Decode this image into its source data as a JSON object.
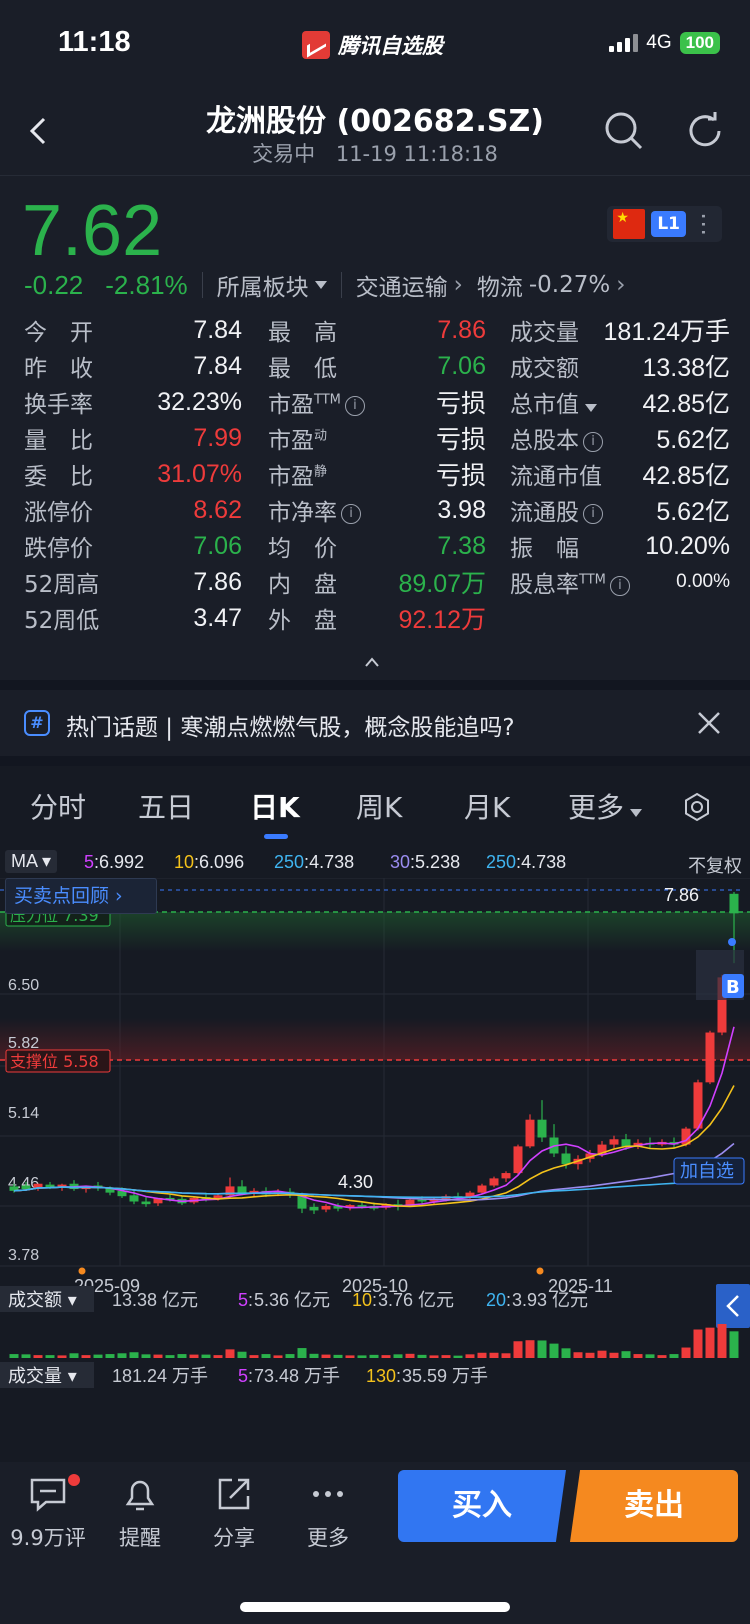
{
  "status_bar": {
    "time": "11:18",
    "app_name": "腾讯自选股",
    "network": "4G",
    "battery": "100"
  },
  "nav": {
    "title": "龙洲股份 (002682.SZ)",
    "trading_status": "交易中",
    "datetime": "11-19 11:18:18"
  },
  "quote": {
    "price": "7.62",
    "change_abs": "-0.22",
    "change_pct": "-2.81%",
    "sector_label": "所属板块",
    "industry_name": "交通运输",
    "sub_industry": "物流",
    "sub_industry_pct": "-0.27%",
    "market_badge": "L1"
  },
  "stats": {
    "open_label": "今　开",
    "open": "7.84",
    "high_label": "最　高",
    "high": "7.86",
    "volume_label": "成交量",
    "volume": "181.24万手",
    "prev_close_label": "昨　收",
    "prev_close": "7.84",
    "low_label": "最　低",
    "low": "7.06",
    "turnover_label": "成交额",
    "turnover": "13.38亿",
    "turnover_rate_label": "换手率",
    "turnover_rate": "32.23%",
    "pe_ttm_label": "市盈",
    "pe_ttm_sup": "TTM",
    "pe_ttm": "亏损",
    "mkt_cap_label": "总市值",
    "mkt_cap": "42.85亿",
    "vol_ratio_label": "量　比",
    "vol_ratio": "7.99",
    "pe_dyn_label": "市盈",
    "pe_dyn_sup": "动",
    "pe_dyn": "亏损",
    "total_shares_label": "总股本",
    "total_shares": "5.62亿",
    "order_ratio_label": "委　比",
    "order_ratio": "31.07%",
    "pe_static_label": "市盈",
    "pe_static_sup": "静",
    "pe_static": "亏损",
    "float_cap_label": "流通市值",
    "float_cap": "42.85亿",
    "limit_up_label": "涨停价",
    "limit_up": "8.62",
    "pb_label": "市净率",
    "pb": "3.98",
    "float_shares_label": "流通股",
    "float_shares": "5.62亿",
    "limit_down_label": "跌停价",
    "limit_down": "7.06",
    "avg_price_label": "均　价",
    "avg_price": "7.38",
    "amplitude_label": "振　幅",
    "amplitude": "10.20%",
    "high52_label": "52周高",
    "high52": "7.86",
    "inner_label": "内　盘",
    "inner": "89.07万",
    "dividend_label": "股息率",
    "dividend_sup": "TTM",
    "dividend": "0.00%",
    "low52_label": "52周低",
    "low52": "3.47",
    "outer_label": "外　盘",
    "outer": "92.12万"
  },
  "topic": {
    "label": "热门话题",
    "text": "寒潮点燃燃气股，概念股能追吗?"
  },
  "chart_tabs": [
    "分时",
    "五日",
    "日K",
    "周K",
    "月K",
    "更多"
  ],
  "ma": {
    "selector": "MA",
    "items": [
      {
        "key": "5",
        "value": "6.992",
        "color": "#d040ff"
      },
      {
        "key": "10",
        "value": "6.096",
        "color": "#f4c21b"
      },
      {
        "key": "250",
        "value": "4.738",
        "color": "#3fb4f0"
      },
      {
        "key": "30",
        "value": "5.238",
        "color": "#9a8cf0"
      },
      {
        "key": "250",
        "value": "4.738",
        "color": "#3fb4f0"
      }
    ],
    "adjust": "不复权"
  },
  "review_button": "买卖点回顾",
  "chart_data": {
    "type": "candlestick",
    "y_ticks": [
      "6.50",
      "5.82",
      "5.14",
      "4.46",
      "3.78"
    ],
    "x_ticks": [
      "2025-09",
      "2025-10",
      "2025-11"
    ],
    "resistance_label": "压力位 7.39",
    "support_label": "支撑位 5.58",
    "high_label": "7.86",
    "low_label": "4.30",
    "buy_marker": "B",
    "watchlist_label": "加自选",
    "candles": [
      [
        4.55,
        4.58,
        4.5,
        4.48
      ],
      [
        4.56,
        4.6,
        4.52,
        4.5
      ],
      [
        4.53,
        4.56,
        4.58,
        4.5
      ],
      [
        4.57,
        4.6,
        4.54,
        4.52
      ],
      [
        4.55,
        4.58,
        4.57,
        4.5
      ],
      [
        4.58,
        4.62,
        4.52,
        4.5
      ],
      [
        4.52,
        4.56,
        4.55,
        4.48
      ],
      [
        4.56,
        4.6,
        4.53,
        4.5
      ],
      [
        4.53,
        4.55,
        4.48,
        4.45
      ],
      [
        4.5,
        4.54,
        4.44,
        4.42
      ],
      [
        4.45,
        4.5,
        4.38,
        4.35
      ],
      [
        4.38,
        4.43,
        4.35,
        4.32
      ],
      [
        4.36,
        4.4,
        4.42,
        4.33
      ],
      [
        4.42,
        4.47,
        4.4,
        4.38
      ],
      [
        4.41,
        4.44,
        4.36,
        4.34
      ],
      [
        4.37,
        4.43,
        4.42,
        4.35
      ],
      [
        4.43,
        4.48,
        4.4,
        4.38
      ],
      [
        4.41,
        4.46,
        4.45,
        4.39
      ],
      [
        4.45,
        4.65,
        4.55,
        4.42
      ],
      [
        4.55,
        4.62,
        4.48,
        4.45
      ],
      [
        4.48,
        4.53,
        4.5,
        4.44
      ],
      [
        4.5,
        4.54,
        4.46,
        4.43
      ],
      [
        4.47,
        4.52,
        4.49,
        4.44
      ],
      [
        4.49,
        4.53,
        4.45,
        4.42
      ],
      [
        4.45,
        4.48,
        4.3,
        4.25
      ],
      [
        4.32,
        4.36,
        4.28,
        4.24
      ],
      [
        4.29,
        4.35,
        4.33,
        4.26
      ],
      [
        4.33,
        4.36,
        4.3,
        4.27
      ],
      [
        4.31,
        4.35,
        4.34,
        4.28
      ],
      [
        4.34,
        4.38,
        4.32,
        4.3
      ],
      [
        4.33,
        4.37,
        4.3,
        4.28
      ],
      [
        4.31,
        4.36,
        4.35,
        4.29
      ],
      [
        4.35,
        4.4,
        4.33,
        4.28
      ],
      [
        4.34,
        4.42,
        4.4,
        4.32
      ],
      [
        4.4,
        4.44,
        4.38,
        4.34
      ],
      [
        4.38,
        4.42,
        4.41,
        4.35
      ],
      [
        4.41,
        4.46,
        4.44,
        4.38
      ],
      [
        4.44,
        4.48,
        4.43,
        4.4
      ],
      [
        4.43,
        4.5,
        4.48,
        4.41
      ],
      [
        4.48,
        4.58,
        4.56,
        4.46
      ],
      [
        4.56,
        4.66,
        4.64,
        4.54
      ],
      [
        4.64,
        4.72,
        4.7,
        4.6
      ],
      [
        4.7,
        5.02,
        5.0,
        4.68
      ],
      [
        5.0,
        5.36,
        5.3,
        4.98
      ],
      [
        5.3,
        5.52,
        5.1,
        5.05
      ],
      [
        5.1,
        5.25,
        4.92,
        4.88
      ],
      [
        4.92,
        5.0,
        4.8,
        4.75
      ],
      [
        4.8,
        4.9,
        4.86,
        4.74
      ],
      [
        4.86,
        4.96,
        4.92,
        4.82
      ],
      [
        4.92,
        5.06,
        5.02,
        4.88
      ],
      [
        5.02,
        5.12,
        5.08,
        4.98
      ],
      [
        5.08,
        5.14,
        5.0,
        4.96
      ],
      [
        5.0,
        5.08,
        5.04,
        4.97
      ],
      [
        5.04,
        5.1,
        5.02,
        4.98
      ],
      [
        5.02,
        5.08,
        5.05,
        5.0
      ],
      [
        5.05,
        5.1,
        5.02,
        4.98
      ],
      [
        5.02,
        5.22,
        5.2,
        5.0
      ],
      [
        5.2,
        5.75,
        5.72,
        5.18
      ],
      [
        5.72,
        6.3,
        6.28,
        5.7
      ],
      [
        6.28,
        6.93,
        6.9,
        6.25
      ],
      [
        7.84,
        7.86,
        7.62,
        7.06
      ]
    ],
    "volume_header": {
      "selector": "成交额",
      "total": "13.38 亿元",
      "ma5_key": "5",
      "ma5": "5.36 亿元",
      "ma10_key": "10",
      "ma10": "3.76 亿元",
      "ma20_key": "20",
      "ma20": "3.93 亿元"
    },
    "volume2_header": {
      "selector": "成交量",
      "total": "181.24 万手",
      "ma5_key": "5",
      "ma5": "73.48 万手",
      "ma130_key": "130",
      "ma130": "35.59 万手"
    }
  },
  "bottom_bar": {
    "comments": "9.9万评",
    "remind": "提醒",
    "share": "分享",
    "more": "更多",
    "buy": "买入",
    "sell": "卖出"
  }
}
